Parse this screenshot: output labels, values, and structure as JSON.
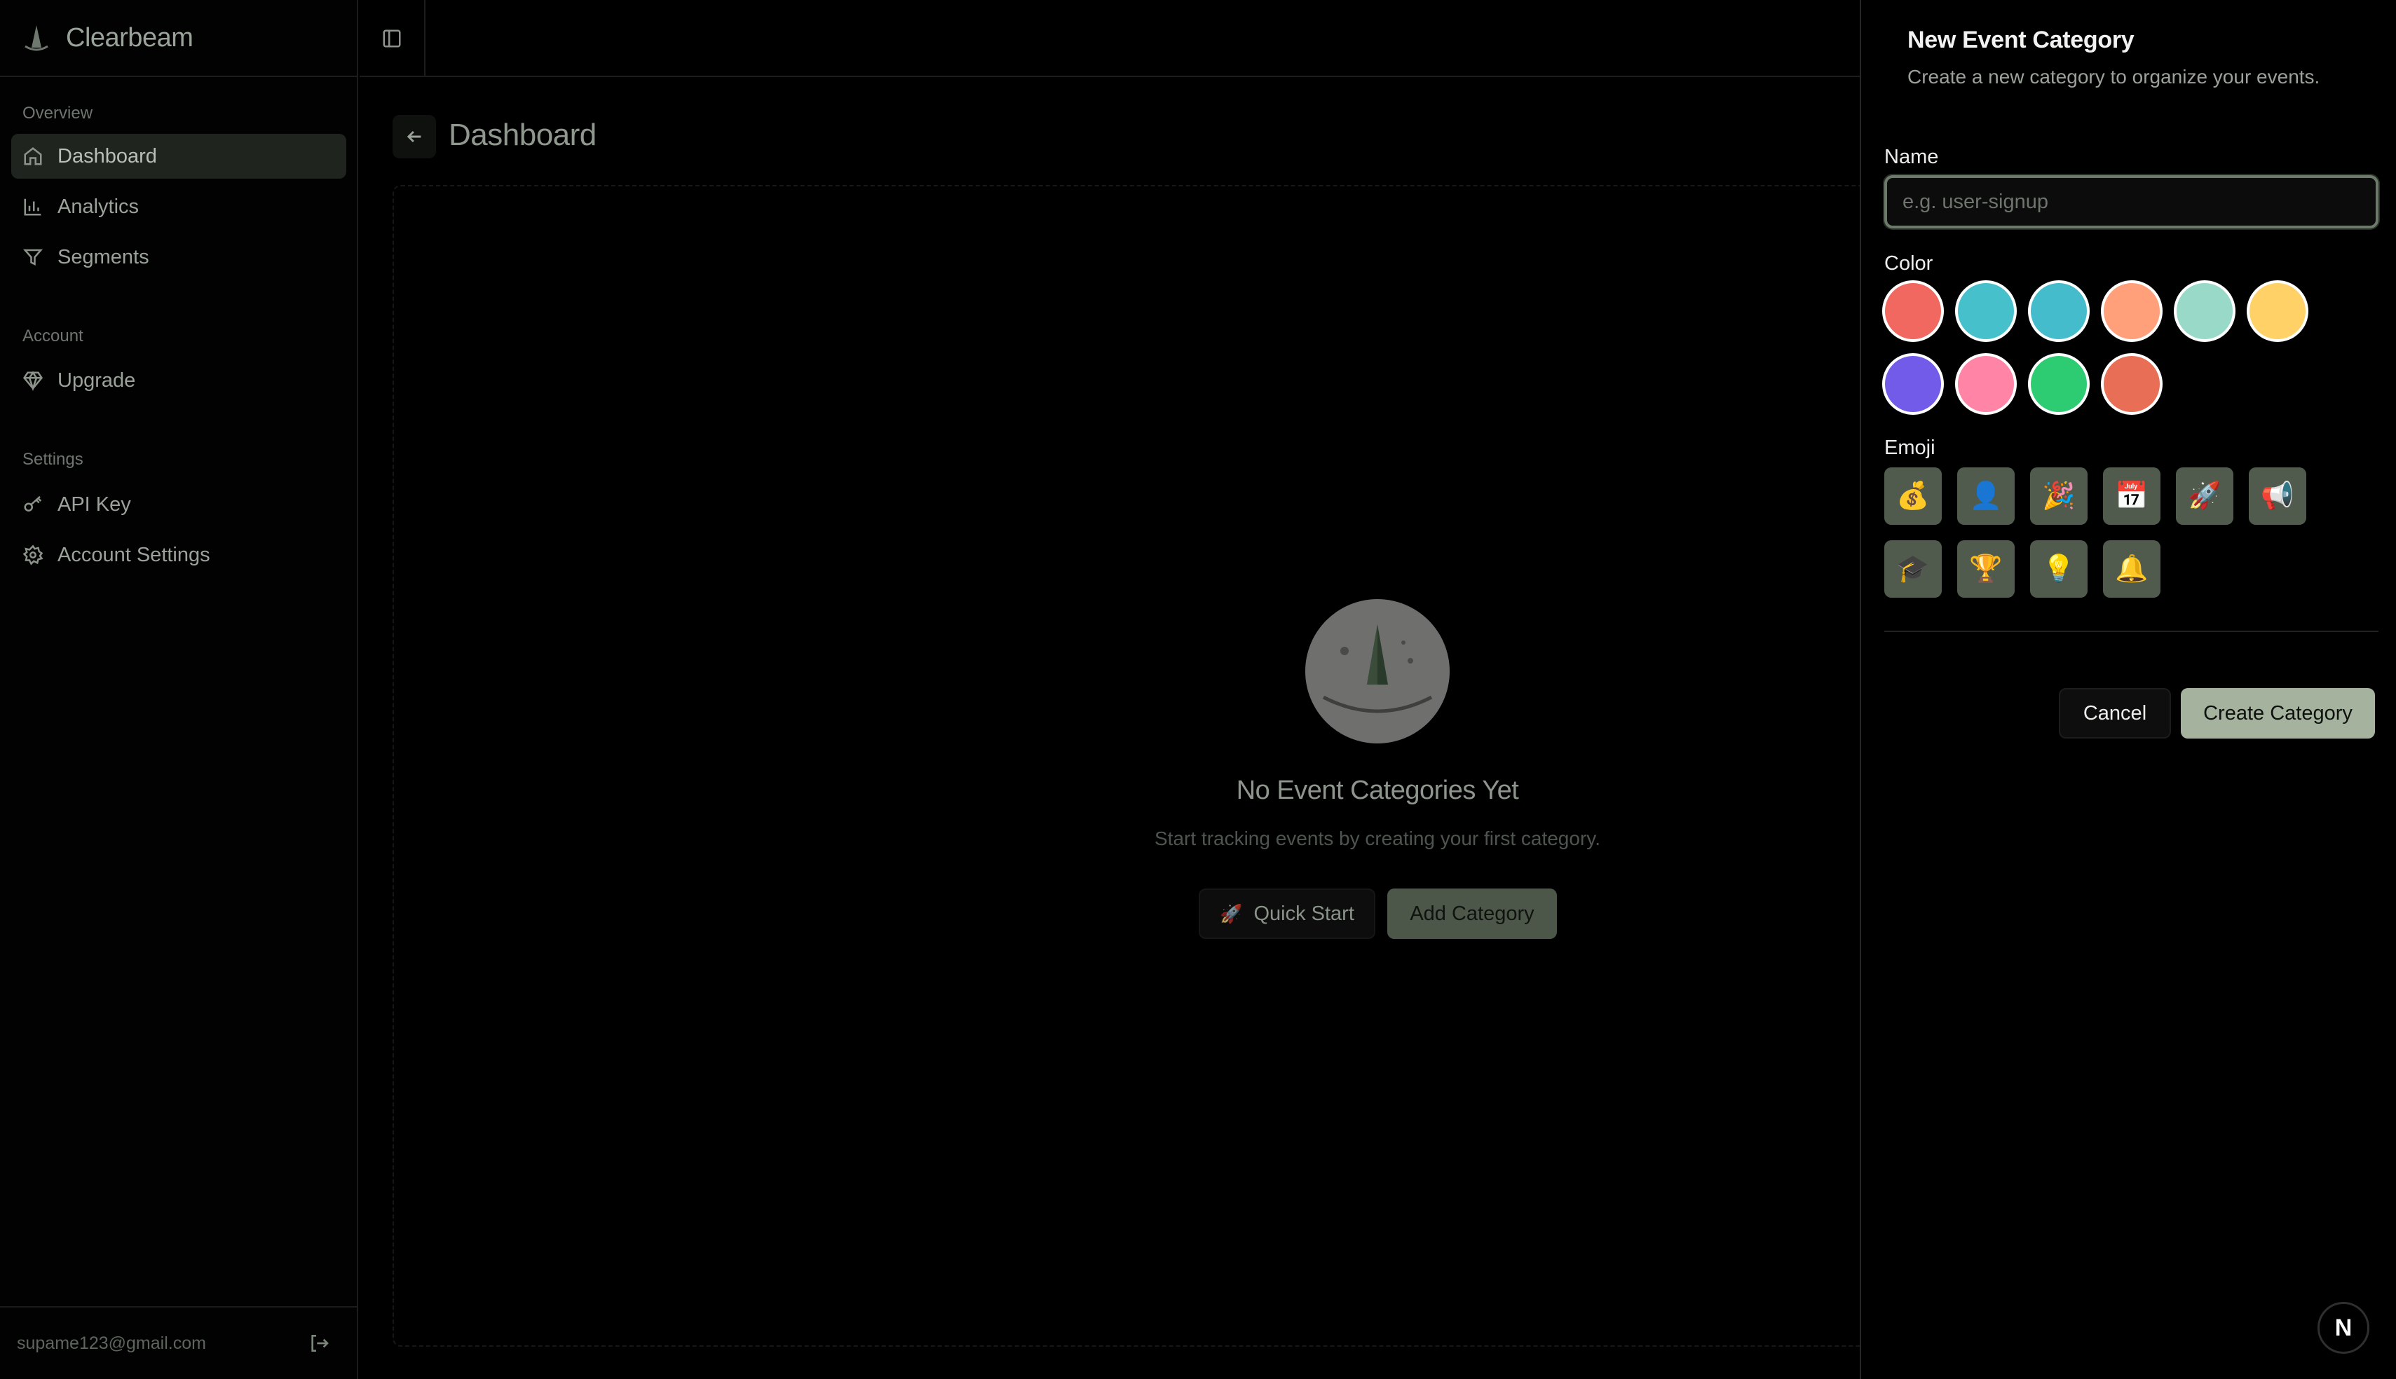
{
  "app": {
    "brand": "Clearbeam"
  },
  "sidebar": {
    "sections": [
      {
        "label": "Overview",
        "items": [
          {
            "label": "Dashboard",
            "icon": "home-icon",
            "active": true
          },
          {
            "label": "Analytics",
            "icon": "bar-chart-icon"
          },
          {
            "label": "Segments",
            "icon": "filter-icon"
          }
        ]
      },
      {
        "label": "Account",
        "items": [
          {
            "label": "Upgrade",
            "icon": "gem-icon"
          }
        ]
      },
      {
        "label": "Settings",
        "items": [
          {
            "label": "API Key",
            "icon": "key-icon"
          },
          {
            "label": "Account Settings",
            "icon": "gear-icon"
          }
        ]
      }
    ],
    "footer": {
      "email": "supame123@gmail.com",
      "logout_icon": "logout-icon"
    }
  },
  "main": {
    "title": "Dashboard",
    "empty_state": {
      "title": "No Event Categories Yet",
      "subtitle": "Start tracking events by creating your first category.",
      "quick_start_label": "Quick Start",
      "quick_start_icon": "🚀",
      "add_category_label": "Add Category"
    }
  },
  "drawer": {
    "title": "New Event Category",
    "subtitle": "Create a new category to organize your events.",
    "name_label": "Name",
    "name_placeholder": "e.g. user-signup",
    "name_value": "",
    "color_label": "Color",
    "colors": [
      "#f0685f",
      "#46c1cc",
      "#44bccb",
      "#ffa07a",
      "#98d9c7",
      "#ffd166",
      "#735bea",
      "#ff84a6",
      "#2ecc72",
      "#e86e56"
    ],
    "emoji_label": "Emoji",
    "emojis": [
      "💰",
      "👤",
      "🎉",
      "📅",
      "🚀",
      "📢",
      "🎓",
      "🏆",
      "💡",
      "🔔"
    ],
    "cancel_label": "Cancel",
    "create_label": "Create Category"
  },
  "badge": {
    "letter": "N"
  },
  "colors": {
    "background": "#000000",
    "accent": "#a4b29e",
    "accent_muted": "#4d5749",
    "sidebar_active": "#20241f"
  }
}
